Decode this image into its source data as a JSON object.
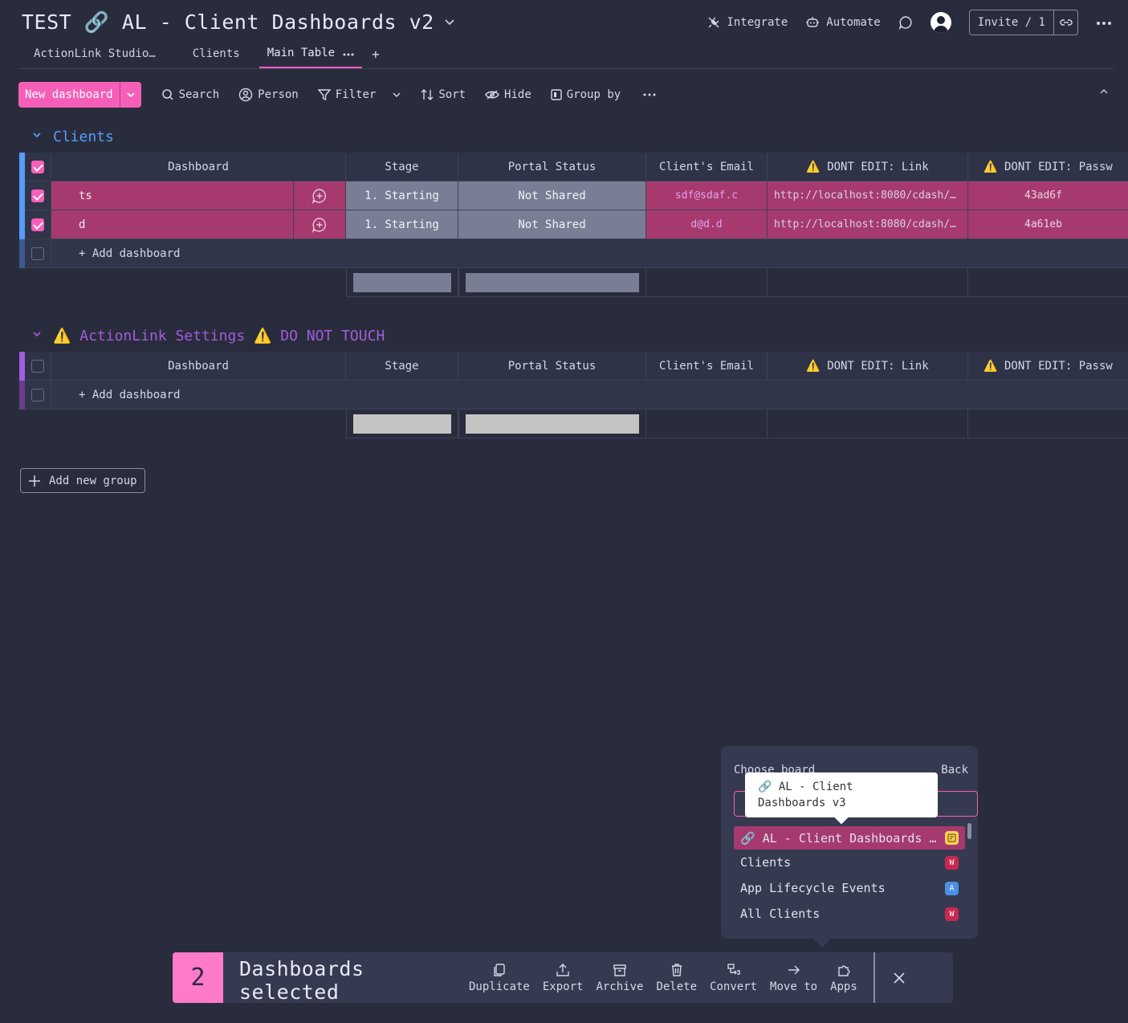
{
  "header": {
    "title": "TEST 🔗 AL - Client Dashboards v2",
    "integrate": "Integrate",
    "automate": "Automate",
    "invite": "Invite / 1"
  },
  "tabs": [
    {
      "label": "ActionLink Studio…"
    },
    {
      "label": "Clients"
    },
    {
      "label": "Main Table"
    }
  ],
  "toolbar": {
    "new_item": "New dashboard",
    "search": "Search",
    "person": "Person",
    "filter": "Filter",
    "sort": "Sort",
    "hide": "Hide",
    "group_by": "Group by"
  },
  "columns": {
    "dashboard": "Dashboard",
    "stage": "Stage",
    "portal": "Portal Status",
    "email": "Client's Email",
    "link": "⚠️ DONT EDIT: Link",
    "pass": "⚠️ DONT EDIT: Passw"
  },
  "groups": [
    {
      "title": "Clients",
      "color": "#579bfc",
      "rows": [
        {
          "name": "ts",
          "stage": "1. Starting",
          "portal": "Not Shared",
          "email": "sdf@sdaf.c",
          "link": "http://localhost:8080/cdash/…",
          "pass": "43ad6f"
        },
        {
          "name": "d",
          "stage": "1. Starting",
          "portal": "Not Shared",
          "email": "d@d.d",
          "link": "http://localhost:8080/cdash/…",
          "pass": "4a61eb"
        }
      ],
      "add_label": "+ Add dashboard"
    },
    {
      "title": "⚠️ ActionLink Settings ⚠️ DO NOT TOUCH",
      "color": "#a25ddc",
      "rows": [],
      "add_label": "+ Add dashboard"
    }
  ],
  "add_group": "Add new group",
  "move_popup": {
    "title": "Choose board",
    "back": "Back",
    "tooltip": "🔗 AL - Client Dashboards v3",
    "boards": [
      {
        "name": "🔗 AL - Client Dashboards v3",
        "display": "🔗 AL - Client Dashboards …",
        "badge": "",
        "badge_color": "#fdd05a"
      },
      {
        "name": "Clients",
        "display": "Clients",
        "badge": "W",
        "badge_color": "#c6294f"
      },
      {
        "name": "App Lifecycle Events",
        "display": "App Lifecycle Events",
        "badge": "A",
        "badge_color": "#4a90e2"
      },
      {
        "name": "All Clients",
        "display": "All Clients",
        "badge": "W",
        "badge_color": "#c6294f"
      }
    ]
  },
  "selection_bar": {
    "count": "2",
    "label": "Dashboards selected",
    "actions": [
      "Duplicate",
      "Export",
      "Archive",
      "Delete",
      "Convert",
      "Move to",
      "Apps"
    ]
  }
}
